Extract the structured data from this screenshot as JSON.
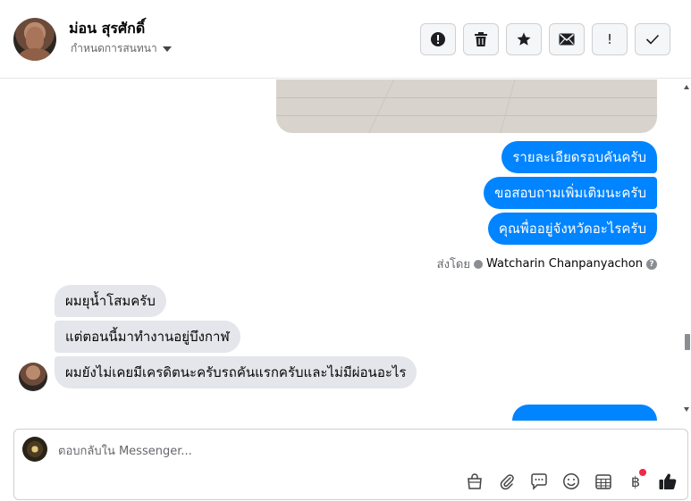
{
  "header": {
    "contact_name": "ม่อน สุรศักดิ์",
    "subtitle": "กำหนดการสนทนา",
    "actions": [
      {
        "name": "report",
        "icon": "exclamation-circle-icon"
      },
      {
        "name": "delete",
        "icon": "trash-icon"
      },
      {
        "name": "star",
        "icon": "star-icon"
      },
      {
        "name": "mark-unread",
        "icon": "envelope-icon"
      },
      {
        "name": "important",
        "icon": "exclamation-icon",
        "label": "!"
      },
      {
        "name": "done",
        "icon": "check-icon"
      }
    ]
  },
  "thread": {
    "outgoing": [
      "รายละเอียดรอบคันครับ",
      "ขอสอบถามเพิ่มเติมนะครับ",
      "คุณพื่ออยู่จังหวัดอะไรครับ"
    ],
    "sent_by_prefix": "ส่งโดย",
    "sent_by_name": "Watcharin Chanpanyachon",
    "incoming": [
      "ผมยุน้ำโสมครับ",
      "แต่ตอนนี้มาทำงานอยู่บึงกาฬ",
      "ผมยังไม่เคยมีเครดิตนะครับรถคันแรกครับและไม่มีผ่อนอะไร"
    ]
  },
  "composer": {
    "placeholder": "ตอบกลับใน Messenger...",
    "tools": [
      "bag-icon",
      "paperclip-icon",
      "saved-replies-icon",
      "emoji-icon",
      "calendar-icon",
      "baht-icon",
      "thumbs-up-icon"
    ],
    "baht_symbol": "฿"
  },
  "colors": {
    "outgoing_bubble": "#0084ff",
    "incoming_bubble": "#e4e6eb",
    "notification_dot": "#f02849"
  }
}
